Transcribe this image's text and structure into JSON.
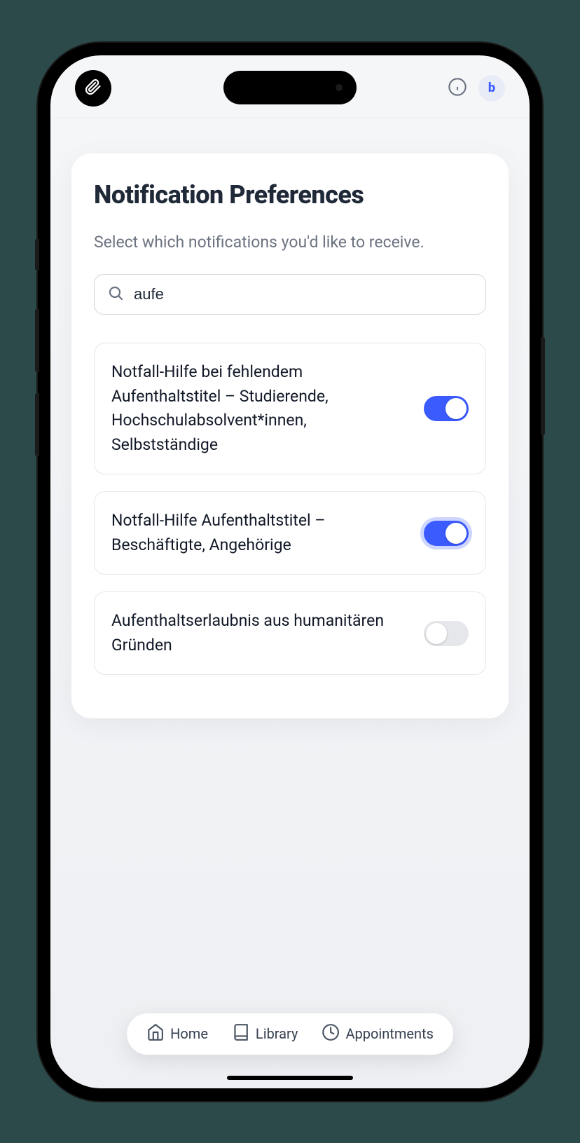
{
  "profile": {
    "initial": "b"
  },
  "card": {
    "title": "Notification Preferences",
    "subtitle": "Select which notifications you'd like to receive."
  },
  "search": {
    "value": "aufe",
    "placeholder": ""
  },
  "preferences": [
    {
      "label": "Notfall-Hilfe bei fehlendem Aufenthaltstitel – Studierende, Hochschulabsolvent*innen, Selbstständige",
      "enabled": true,
      "focused": false
    },
    {
      "label": "Notfall-Hilfe Aufenthaltstitel – Beschäftigte, Angehörige",
      "enabled": true,
      "focused": true
    },
    {
      "label": "Aufenthaltserlaubnis aus humanitären Gründen",
      "enabled": false,
      "focused": false
    }
  ],
  "nav": {
    "home": "Home",
    "library": "Library",
    "appointments": "Appointments"
  }
}
